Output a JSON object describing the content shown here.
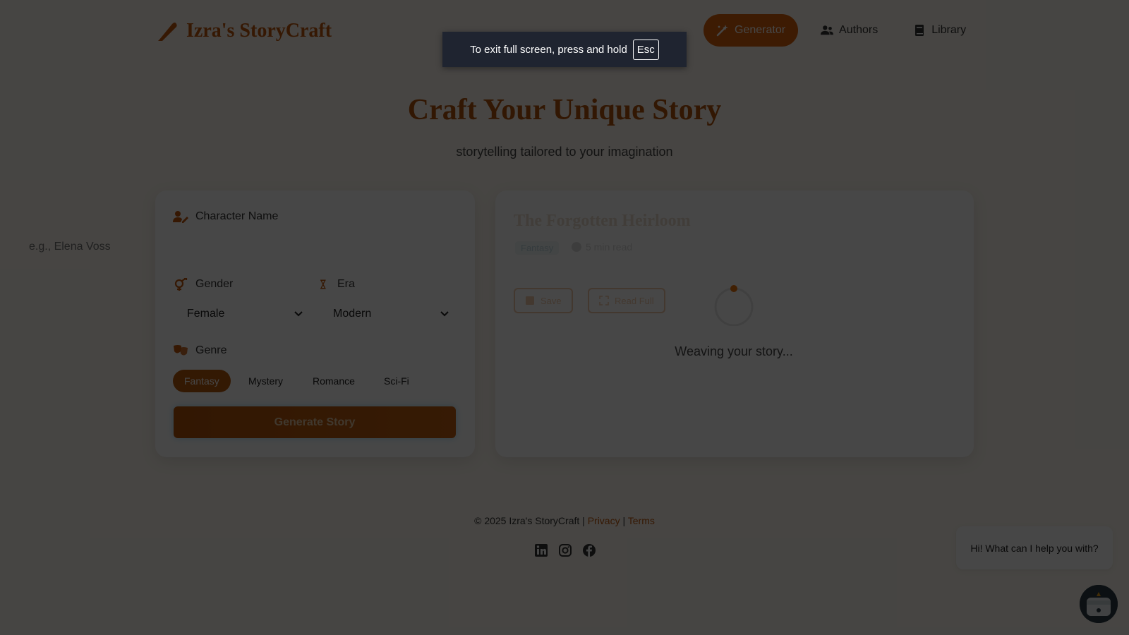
{
  "header": {
    "brand": "Izra's StoryCraft",
    "nav": [
      {
        "label": "Generator",
        "icon": "magic-wand-icon",
        "active": true
      },
      {
        "label": "Authors",
        "icon": "users-icon",
        "active": false
      },
      {
        "label": "Library",
        "icon": "book-icon",
        "active": false
      }
    ]
  },
  "hero": {
    "title": "Craft Your Unique Story",
    "subtitle": "storytelling tailored to your imagination"
  },
  "form": {
    "character_label": "Character Name",
    "character_placeholder": "e.g., Elena Voss",
    "gender_label": "Gender",
    "gender_value": "Female",
    "era_label": "Era",
    "era_value": "Modern",
    "genre_label": "Genre",
    "genres": [
      "Fantasy",
      "Mystery",
      "Romance",
      "Sci-Fi"
    ],
    "selected_genre": "Fantasy",
    "generate_label": "Generate Story"
  },
  "story": {
    "title": "The Forgotten Heirloom",
    "genre_badge": "Fantasy",
    "read_time": "5 min read",
    "save_label": "Save",
    "read_label": "Read Full",
    "loading_text": "Weaving your story..."
  },
  "footer": {
    "copyright": "© 2025 Izra's StoryCraft |",
    "privacy": "Privacy",
    "separator": "|",
    "terms": "Terms",
    "socials": [
      "linkedin-icon",
      "instagram-icon",
      "facebook-icon"
    ]
  },
  "chat": {
    "message": "Hi! What can I help you with?"
  },
  "fullscreen_toast": {
    "text": "To exit full screen, press and hold",
    "key": "Esc"
  },
  "colors": {
    "brand": "#c2570c",
    "accent": "#d9620e",
    "overlay": "rgba(0,0,0,0.72)"
  }
}
